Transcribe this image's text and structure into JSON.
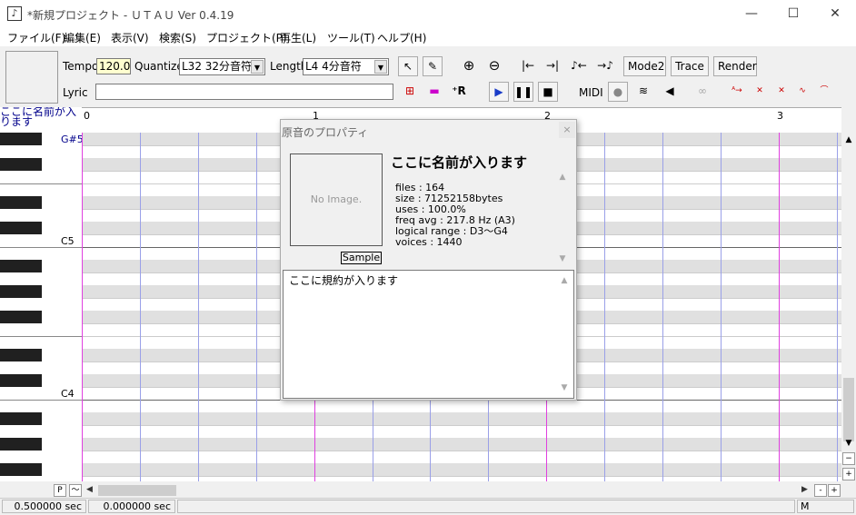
{
  "window": {
    "title": "*新規プロジェクト - ＵＴＡＵ Ver 0.4.19",
    "minimize": "—",
    "maximize": "☐",
    "close": "✕"
  },
  "menu": [
    "ファイル(F)",
    "編集(E)",
    "表示(V)",
    "検索(S)",
    "プロジェクト(P)",
    "再生(L)",
    "ツール(T)",
    "ヘルプ(H)"
  ],
  "toolbar": {
    "tempo_label": "Tempo",
    "tempo_value": "120.0",
    "quantize_label": "Quantize",
    "quantize_value": "L32 32分音符",
    "length_label": "Length",
    "length_value": "L4  4分音符",
    "lyric_label": "Lyric",
    "lyric_value": "",
    "mode2": "Mode2",
    "trace": "Trace",
    "render": "Render",
    "midi": "MIDI"
  },
  "singer_name": "ここに名前が入ります",
  "ruler": [
    "0",
    "1",
    "2",
    "3"
  ],
  "keys": {
    "top_label": "G#5",
    "c5": "C5",
    "c4": "C4"
  },
  "bottom": {
    "p_button": "P",
    "tilde_button": "〜",
    "minus": "-",
    "plus": "+",
    "zoom_plus": "+",
    "zoom_minus": "−"
  },
  "status": {
    "time1": "0.500000 sec",
    "time2": "0.000000 sec",
    "mode": "M"
  },
  "dialog": {
    "title": "原音のプロパティ",
    "close": "×",
    "image_placeholder": "No Image.",
    "name": "ここに名前が入ります",
    "sample_button": "Sample",
    "files": "files : 164",
    "size": "size :  71252158bytes",
    "uses": "uses : 100.0%",
    "freq": "freq avg : 217.8 Hz (A3)",
    "range": "logical range : D3〜G4",
    "voices": "voices : 1440",
    "terms": "ここに規約が入ります"
  }
}
